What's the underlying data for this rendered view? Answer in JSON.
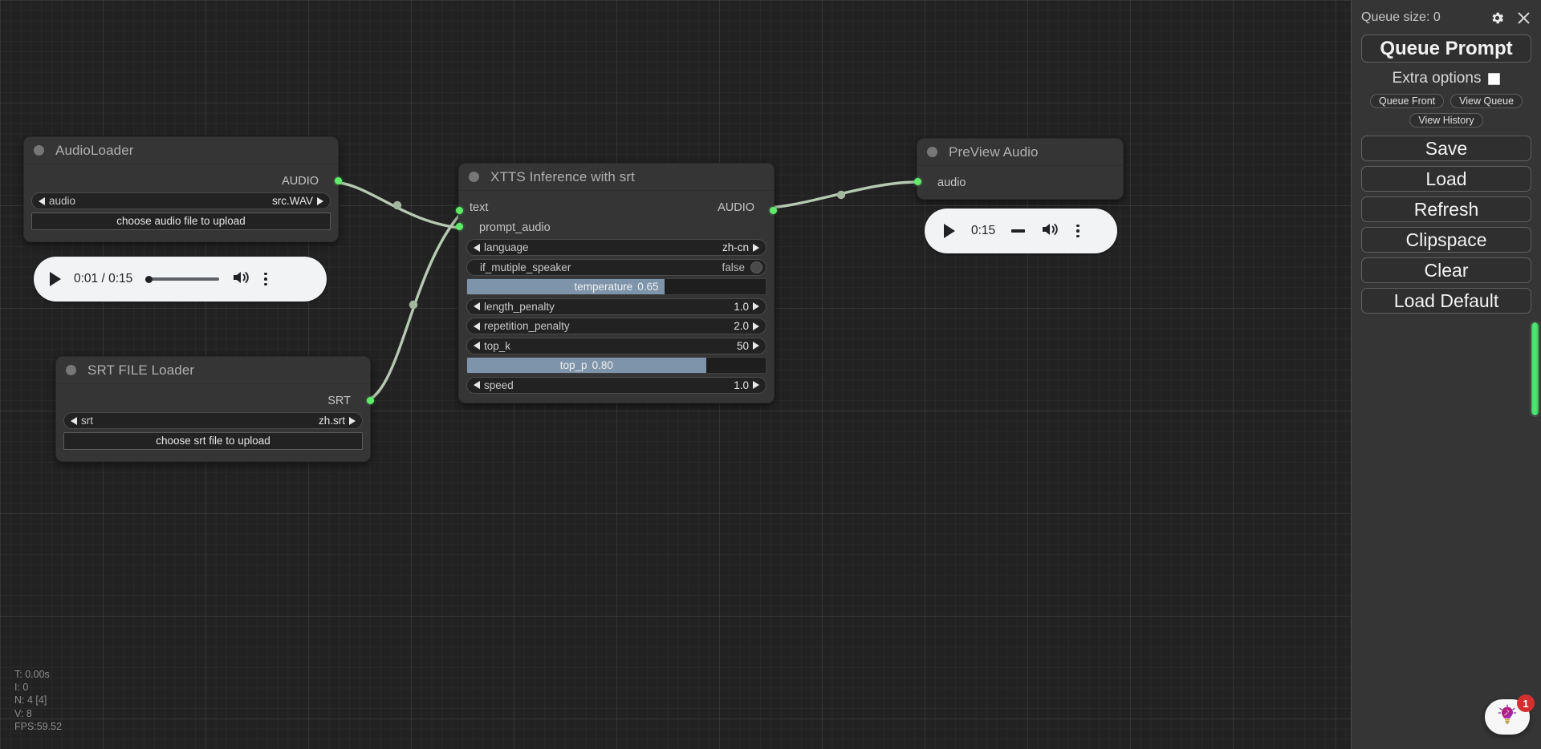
{
  "canvas": {
    "stats": {
      "time": "T: 0.00s",
      "iterations": "I: 0",
      "nodes": "N: 4 [4]",
      "vertices": "V: 8",
      "fps": "FPS:59.52"
    }
  },
  "nodes": {
    "audio_loader": {
      "title": "AudioLoader",
      "outputs": [
        {
          "label": "AUDIO"
        }
      ],
      "widgets": [
        {
          "type": "combo",
          "name": "audio",
          "value": "src.WAV"
        },
        {
          "type": "button",
          "label": "choose audio file to upload"
        }
      ],
      "player": {
        "play_label": "play",
        "time": "0:01 / 0:15",
        "volume_label": "volume",
        "menu_label": "more options"
      }
    },
    "srt_loader": {
      "title": "SRT FILE Loader",
      "outputs": [
        {
          "label": "SRT"
        }
      ],
      "widgets": [
        {
          "type": "combo",
          "name": "srt",
          "value": "zh.srt"
        },
        {
          "type": "button",
          "label": "choose srt file to upload"
        }
      ]
    },
    "xtts": {
      "title": "XTTS Inference with srt",
      "inputs": [
        {
          "label": "text"
        },
        {
          "label": "prompt_audio"
        }
      ],
      "outputs": [
        {
          "label": "AUDIO"
        }
      ],
      "widgets": [
        {
          "type": "combo",
          "name": "language",
          "value": "zh-cn"
        },
        {
          "type": "toggle",
          "name": "if_mutiple_speaker",
          "value": "false"
        },
        {
          "type": "slider",
          "name": "temperature",
          "value": "0.65",
          "fill": 66
        },
        {
          "type": "combo",
          "name": "length_penalty",
          "value": "1.0"
        },
        {
          "type": "combo",
          "name": "repetition_penalty",
          "value": "2.0"
        },
        {
          "type": "combo",
          "name": "top_k",
          "value": "50"
        },
        {
          "type": "slider",
          "name": "top_p",
          "value": "0.80",
          "fill": 80
        },
        {
          "type": "combo",
          "name": "speed",
          "value": "1.0"
        }
      ]
    },
    "preview_audio": {
      "title": "PreView Audio",
      "inputs": [
        {
          "label": "audio"
        }
      ],
      "player": {
        "play_label": "play",
        "time": "0:15",
        "volume_label": "volume",
        "menu_label": "more options"
      }
    }
  },
  "sidebar": {
    "queue_size": "Queue size: 0",
    "gear_icon": "gear-icon",
    "close_icon": "close-icon",
    "queue_prompt": "Queue Prompt",
    "extra_options": "Extra options",
    "queue_front": "Queue Front",
    "view_queue": "View Queue",
    "view_history": "View History",
    "buttons": [
      {
        "label": "Save"
      },
      {
        "label": "Load"
      },
      {
        "label": "Refresh"
      },
      {
        "label": "Clipspace"
      },
      {
        "label": "Clear"
      },
      {
        "label": "Load Default"
      }
    ]
  },
  "helper": {
    "icon": "lightbulb-brain-icon",
    "badge": "1"
  },
  "colors": {
    "link": "#b6c9b2",
    "port_green": "#5fec6b",
    "slider_fill": "#7d94aa",
    "badge_red": "#d32f2f",
    "scrollbar_green": "#4ad96a"
  }
}
